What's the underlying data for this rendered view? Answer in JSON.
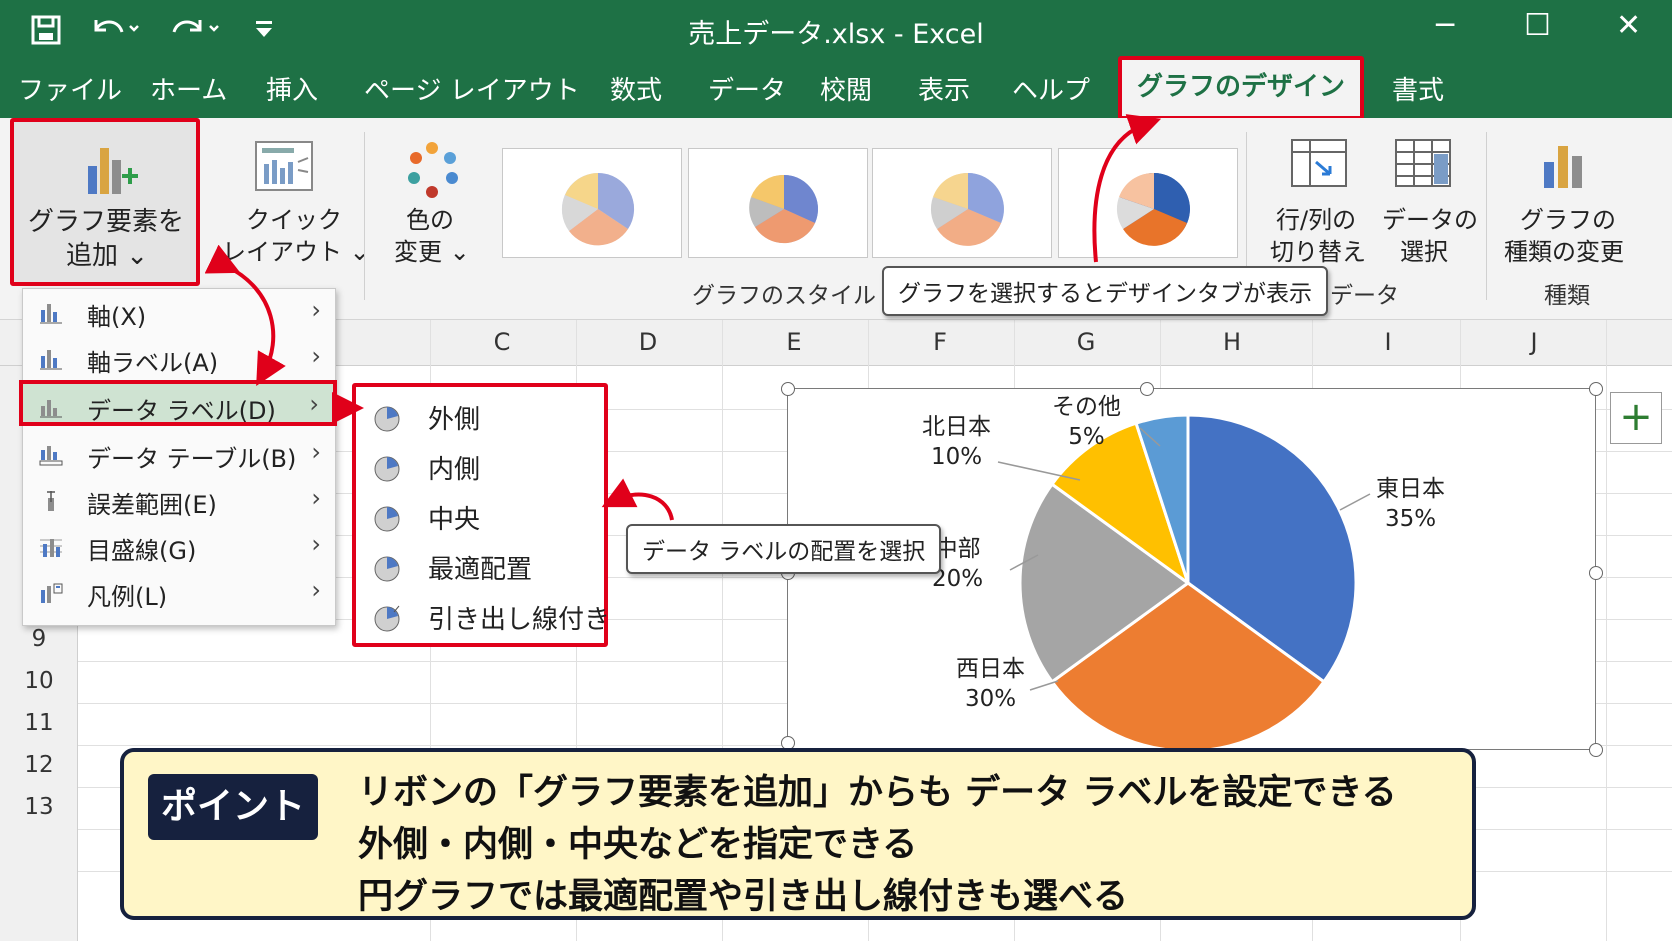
{
  "window": {
    "title": "売上データ.xlsx - Excel",
    "quick_access": [
      "save-icon",
      "undo-icon",
      "redo-icon",
      "customize-icon"
    ],
    "controls": [
      "minimize-icon",
      "maximize-icon",
      "close-icon"
    ],
    "minimize": "─",
    "maximize": "☐",
    "close": "✕"
  },
  "tabs": [
    {
      "label": "ファイル"
    },
    {
      "label": "ホーム"
    },
    {
      "label": "挿入"
    },
    {
      "label": "ページ レイアウト"
    },
    {
      "label": "数式"
    },
    {
      "label": "データ"
    },
    {
      "label": "校閲"
    },
    {
      "label": "表示"
    },
    {
      "label": "ヘルプ"
    },
    {
      "label": "グラフのデザイン",
      "active": true
    },
    {
      "label": "書式"
    }
  ],
  "ribbon": {
    "add_element": {
      "line1": "グラフ要素を",
      "line2": "追加 ⌄"
    },
    "quick_layout": {
      "line1": "クイック",
      "line2": "レイアウト ⌄"
    },
    "colors": {
      "line1": "色の",
      "line2": "変更 ⌄"
    },
    "styles_group_label": "グラフのスタイル",
    "switch_row_col": {
      "line1": "行/列の",
      "line2": "切り替え"
    },
    "select_data": {
      "line1": "データの",
      "line2": "選択"
    },
    "data_group_label": "データ",
    "change_type": {
      "line1": "グラフの",
      "line2": "種類の変更"
    },
    "type_group_label": "種類"
  },
  "columns": [
    "C",
    "D",
    "E",
    "F",
    "G",
    "H",
    "I",
    "J"
  ],
  "rows": [
    "9",
    "10",
    "11",
    "12",
    "13"
  ],
  "menu": {
    "items": [
      {
        "label": "軸(X)",
        "arrow": "›"
      },
      {
        "label": "軸ラベル(A)",
        "arrow": "›"
      },
      {
        "label": "データ ラベル(D)",
        "arrow": "›",
        "selected": true
      },
      {
        "label": "データ テーブル(B)",
        "arrow": "›"
      },
      {
        "label": "誤差範囲(E)",
        "arrow": "›"
      },
      {
        "label": "目盛線(G)",
        "arrow": "›"
      },
      {
        "label": "凡例(L)",
        "arrow": "›"
      }
    ]
  },
  "submenu": {
    "items": [
      {
        "label": "外側"
      },
      {
        "label": "内側"
      },
      {
        "label": "中央"
      },
      {
        "label": "最適配置"
      },
      {
        "label": "引き出し線付き"
      }
    ]
  },
  "callouts": {
    "design_tab": "グラフを選択するとデザインタブが表示",
    "label_position": "データ ラベルの配置を選択"
  },
  "chart_data": {
    "type": "pie",
    "categories": [
      "東日本",
      "西日本",
      "中部",
      "北日本",
      "その他"
    ],
    "values": [
      35,
      30,
      20,
      10,
      5
    ],
    "labels": [
      "35%",
      "30%",
      "20%",
      "10%",
      "5%"
    ],
    "colors": [
      "#4472c4",
      "#ed7d31",
      "#a5a5a5",
      "#ffc000",
      "#5b9bd5"
    ]
  },
  "chart_ui": {
    "plus": "+"
  },
  "point": {
    "badge": "ポイント",
    "lines": [
      "リボンの「グラフ要素を追加」からも データ ラベルを設定できる",
      "外側・内側・中央などを指定できる",
      "円グラフでは最適配置や引き出し線付きも選べる"
    ]
  },
  "colors": {
    "excel_green": "#1e7145",
    "highlight_red": "#e0001a",
    "point_bg": "#fff6c7",
    "point_border": "#16213e"
  }
}
